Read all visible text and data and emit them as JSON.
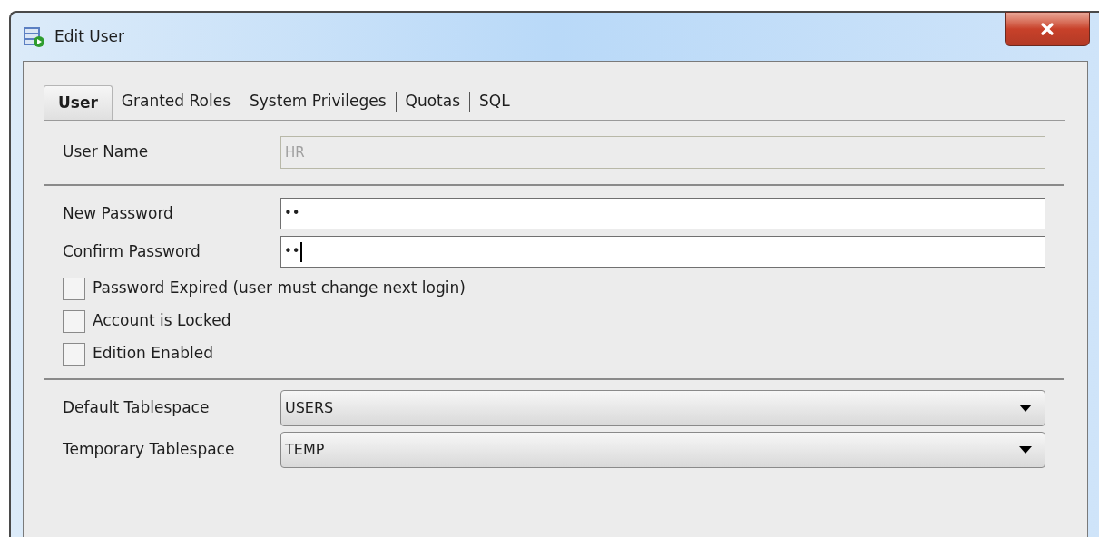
{
  "window": {
    "title": "Edit User"
  },
  "tabs": [
    {
      "label": "User",
      "selected": true
    },
    {
      "label": "Granted Roles",
      "selected": false
    },
    {
      "label": "System Privileges",
      "selected": false
    },
    {
      "label": "Quotas",
      "selected": false
    },
    {
      "label": "SQL",
      "selected": false
    }
  ],
  "user_name": {
    "label": "User Name",
    "value": "HR",
    "disabled": true
  },
  "passwords": [
    {
      "label": "New Password",
      "value": "••",
      "focused": false
    },
    {
      "label": "Confirm Password",
      "value": "••",
      "focused": true
    }
  ],
  "checkboxes": [
    {
      "label": "Password Expired (user must change next login)",
      "checked": false
    },
    {
      "label": "Account is Locked",
      "checked": false
    },
    {
      "label": "Edition Enabled",
      "checked": false
    }
  ],
  "tablespaces": [
    {
      "label": "Default Tablespace",
      "value": "USERS"
    },
    {
      "label": "Temporary Tablespace",
      "value": "TEMP"
    }
  ]
}
